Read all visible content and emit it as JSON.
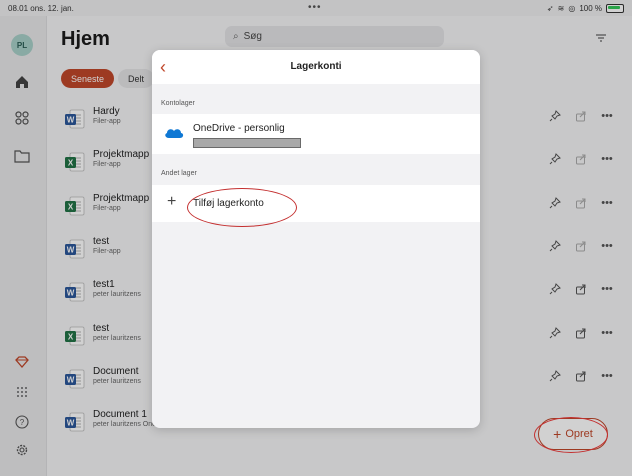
{
  "status_bar": {
    "time": "08.01",
    "date": "ons. 12. jan.",
    "dots": "•••",
    "battery": "100 %"
  },
  "sidebar": {
    "avatar_initials": "PL"
  },
  "main": {
    "title": "Hjem",
    "search_placeholder": "Søg",
    "chips": [
      "Seneste",
      "Delt"
    ],
    "files": [
      {
        "name": "Hardy",
        "sub": "Filer-app",
        "type": "word"
      },
      {
        "name": "Projektmapp",
        "sub": "Filer-app",
        "type": "excel"
      },
      {
        "name": "Projektmapp",
        "sub": "Filer-app",
        "type": "excel"
      },
      {
        "name": "test",
        "sub": "Filer-app",
        "type": "word"
      },
      {
        "name": "test1",
        "sub": "peter lauritzens",
        "type": "word"
      },
      {
        "name": "test",
        "sub": "peter lauritzens",
        "type": "excel"
      },
      {
        "name": "Document",
        "sub": "peter lauritzens",
        "type": "word"
      },
      {
        "name": "Document 1",
        "sub": "peter lauritzens OneDrive",
        "type": "word"
      }
    ],
    "create_button": "Opret"
  },
  "modal": {
    "title": "Lagerkonti",
    "section_account": "Kontolager",
    "account_name": "OneDrive - personlig",
    "section_other": "Andet lager",
    "add_label": "Tilføj lagerkonto"
  },
  "colors": {
    "accent": "#c0472a",
    "word": "#2b579a",
    "excel": "#217346",
    "onedrive": "#0f78d4",
    "annotation": "#c43030"
  }
}
